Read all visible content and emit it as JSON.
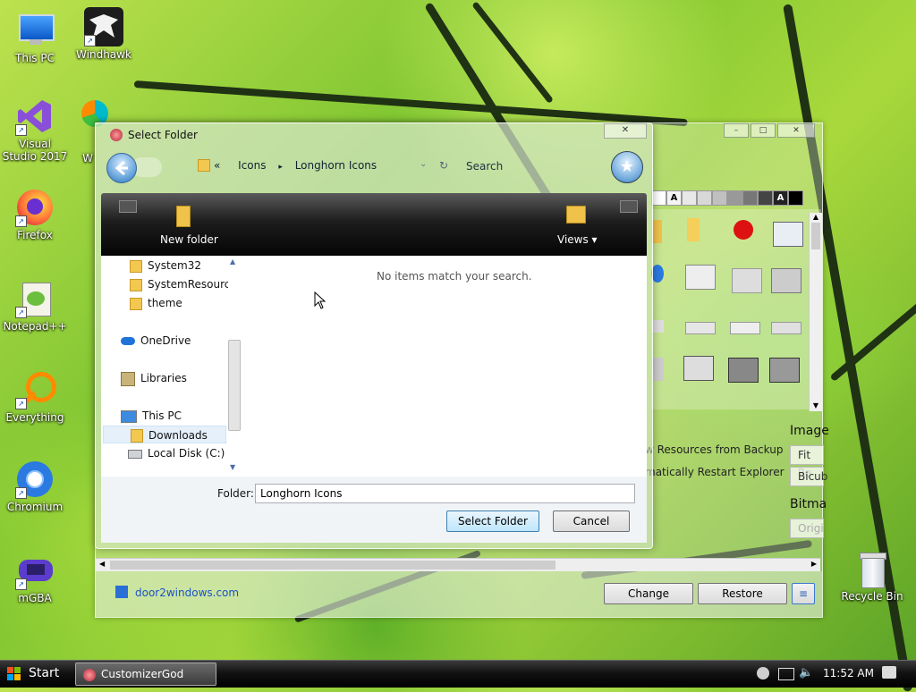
{
  "desktop": {
    "icons_left": [
      {
        "label": "This PC",
        "icon": "pc-icon"
      },
      {
        "label": "Visual Studio 2017",
        "icon": "visual-studio-icon"
      },
      {
        "label": "Firefox",
        "icon": "firefox-icon"
      },
      {
        "label": "Notepad++",
        "icon": "notepad-plus-plus-icon"
      },
      {
        "label": "Everything",
        "icon": "everything-search-icon"
      },
      {
        "label": "Chromium",
        "icon": "chromium-icon"
      },
      {
        "label": "mGBA",
        "icon": "mgba-icon"
      }
    ],
    "windhawk": {
      "label": "Windhawk",
      "icon": "windhawk-icon"
    },
    "partial_label": "W",
    "recycle_bin": {
      "label": "Recycle Bin",
      "icon": "recycle-bin-icon"
    }
  },
  "customizer": {
    "swatch_letters": [
      "A",
      "A"
    ],
    "options": [
      "w Resources from Backup",
      "matically Restart Explorer"
    ],
    "image_label": "Image",
    "fit_label": "Fit Re",
    "bicubic_label": "Bicub",
    "bitmap_label": "Bitma",
    "orig_label": "Origi",
    "link": "door2windows.com",
    "change_label": "Change",
    "restore_label": "Restore",
    "menu_icon": "≡"
  },
  "dialog": {
    "title": "Select Folder",
    "close": "✕",
    "breadcrumb": {
      "chevrons": "«",
      "root": "Icons",
      "sep": "▸",
      "current": "Longhorn Icons"
    },
    "refresh": "↻",
    "search_placeholder": "Search",
    "star": "★",
    "toolbar": {
      "new_folder": "New folder",
      "views": "Views ▾"
    },
    "nav": [
      "System32",
      "SystemResources",
      "theme",
      "OneDrive",
      "Libraries",
      "This PC",
      "Downloads",
      "Local Disk (C:)"
    ],
    "empty_message": "No items match your search.",
    "folder_label": "Folder:",
    "folder_value": "Longhorn Icons",
    "select_folder": "Select Folder",
    "cancel": "Cancel"
  },
  "taskbar": {
    "start": "Start",
    "task_item": "CustomizerGod",
    "time": "11:52 AM"
  }
}
